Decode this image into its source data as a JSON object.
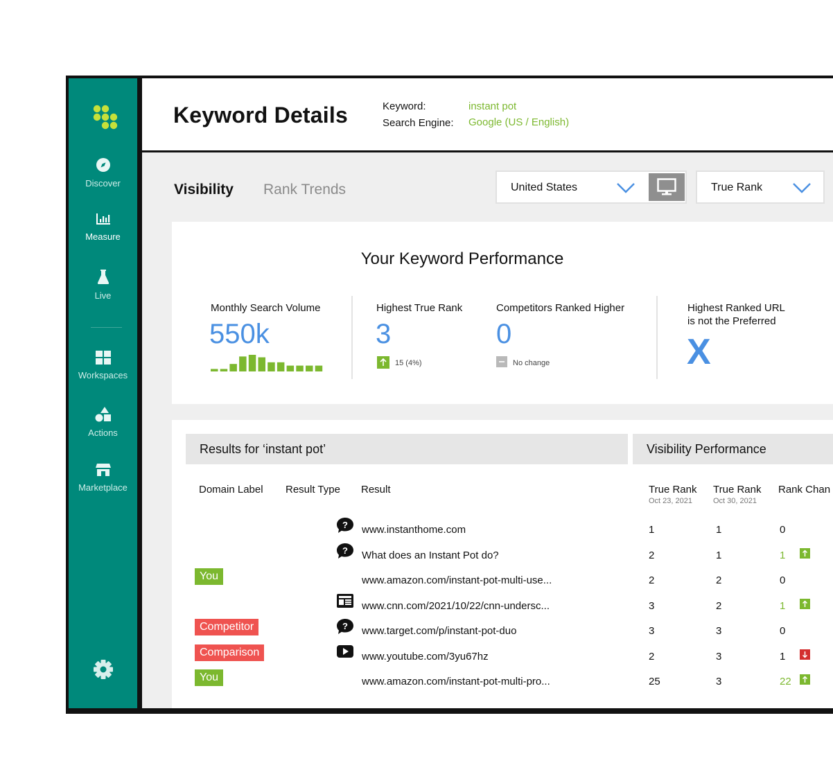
{
  "sidebar": {
    "items": [
      {
        "label": "Discover",
        "icon": "compass-icon"
      },
      {
        "label": "Measure",
        "icon": "bar-chart-icon"
      },
      {
        "label": "Live",
        "icon": "flask-icon"
      },
      {
        "label": "Workspaces",
        "icon": "grid-icon"
      },
      {
        "label": "Actions",
        "icon": "shapes-icon"
      },
      {
        "label": "Marketplace",
        "icon": "store-icon"
      }
    ],
    "active": "Measure"
  },
  "header": {
    "title": "Keyword Details",
    "keyword_label": "Keyword:",
    "keyword_value": "instant pot",
    "engine_label": "Search Engine:",
    "engine_value": "Google (US / English)"
  },
  "tabs": [
    {
      "label": "Visibility",
      "active": true
    },
    {
      "label": "Rank Trends",
      "active": false
    }
  ],
  "filters": {
    "country": "United States",
    "device_icon": "desktop-icon",
    "rank_type": "True Rank"
  },
  "performance": {
    "title": "Your Keyword Performance",
    "search_volume_label": "Monthly Search Volume",
    "search_volume_value": "550k",
    "volume_trend": [
      0.15,
      0.15,
      0.45,
      0.9,
      1.0,
      0.85,
      0.55,
      0.55,
      0.35,
      0.35,
      0.35,
      0.35
    ],
    "highest_rank_label": "Highest True Rank",
    "highest_rank_value": "3",
    "highest_rank_change": "15 (4%)",
    "competitors_label": "Competitors Ranked Higher",
    "competitors_value": "0",
    "competitors_change": "No change",
    "url_label_line1": "Highest Ranked URL",
    "url_label_line2": "is not the Preferred",
    "url_value": "X"
  },
  "results": {
    "title": "Results for ‘instant pot’",
    "visibility_title": "Visibility Performance",
    "columns": {
      "domain_label": "Domain Label",
      "result_type": "Result Type",
      "result": "Result",
      "true_rank_1": "True Rank",
      "true_rank_1_date": "Oct 23, 2021",
      "true_rank_2": "True Rank",
      "true_rank_2_date": "Oct 30, 2021",
      "rank_change": "Rank Chan"
    },
    "rows": [
      {
        "label": "",
        "type": "question-icon",
        "result": "www.instanthome.com",
        "rank1": "1",
        "rank2": "1",
        "change": "0",
        "dir": "none"
      },
      {
        "label": "",
        "type": "question-icon",
        "result": "What does an Instant Pot do?",
        "rank1": "2",
        "rank2": "1",
        "change": "1",
        "dir": "up"
      },
      {
        "label": "You",
        "type": "",
        "result": "www.amazon.com/instant-pot-multi-use...",
        "rank1": "2",
        "rank2": "2",
        "change": "0",
        "dir": "none"
      },
      {
        "label": "",
        "type": "news-icon",
        "result": "www.cnn.com/2021/10/22/cnn-undersc...",
        "rank1": "3",
        "rank2": "2",
        "change": "1",
        "dir": "up"
      },
      {
        "label": "Competitor",
        "type": "question-icon",
        "result": "www.target.com/p/instant-pot-duo",
        "rank1": "3",
        "rank2": "3",
        "change": "0",
        "dir": "none"
      },
      {
        "label": "Comparison",
        "type": "video-icon",
        "result": "www.youtube.com/3yu67hz",
        "rank1": "2",
        "rank2": "3",
        "change": "1",
        "dir": "down"
      },
      {
        "label": "You",
        "type": "",
        "result": "www.amazon.com/instant-pot-multi-pro...",
        "rank1": "25",
        "rank2": "3",
        "change": "22",
        "dir": "up"
      }
    ]
  },
  "colors": {
    "sidebar": "#00897b",
    "accent_green": "#7cb82f",
    "accent_blue": "#4a90e2",
    "badge_red": "#ef5350",
    "arrow_down": "#d32f2f"
  }
}
